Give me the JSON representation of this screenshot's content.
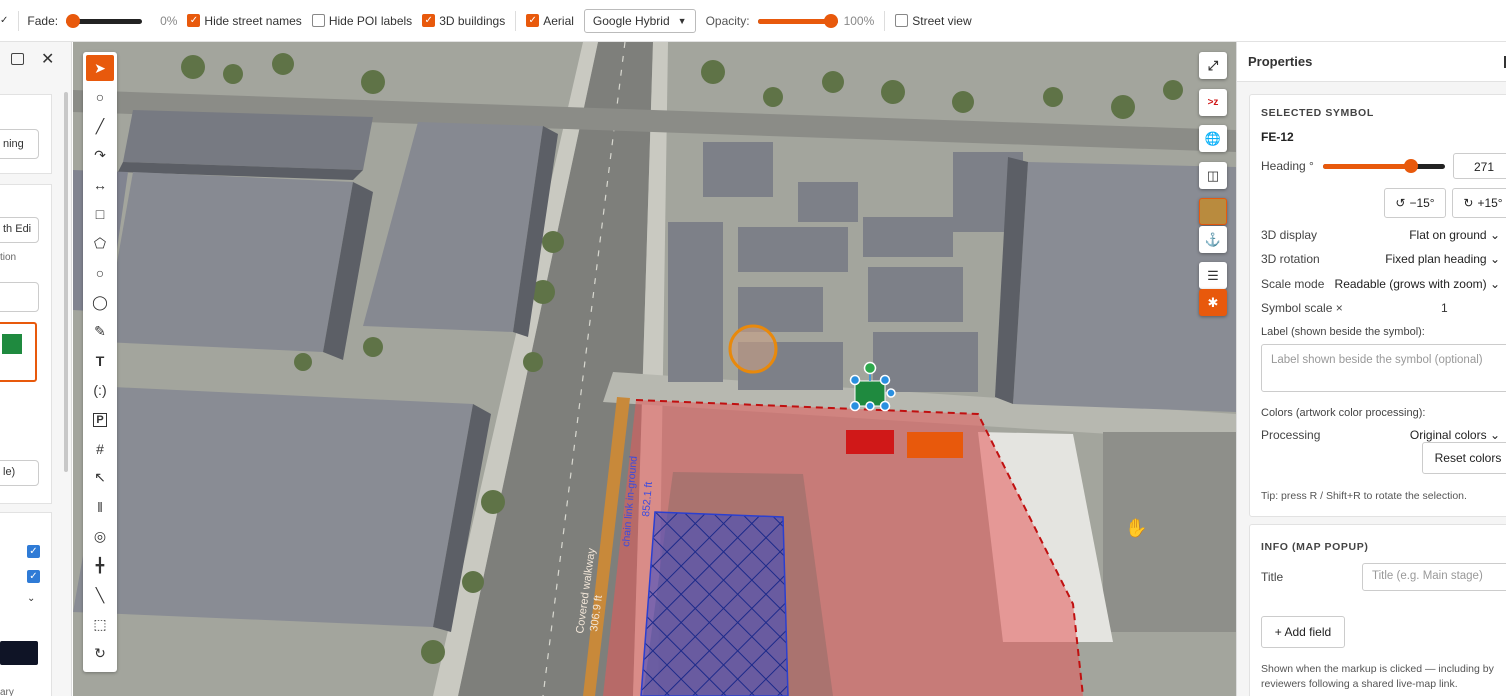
{
  "toolbar": {
    "fade_label": "Fade:",
    "fade_value": 0,
    "fade_text": "0%",
    "hide_street_names": {
      "label": "Hide street names",
      "checked": true
    },
    "hide_poi_labels": {
      "label": "Hide POI labels",
      "checked": false
    },
    "buildings_3d": {
      "label": "3D buildings",
      "checked": true
    },
    "aerial": {
      "label": "Aerial",
      "checked": true
    },
    "basemap_select": "Google Hybrid",
    "opacity_label": "Opacity:",
    "opacity_value": 1.0,
    "opacity_text": "100%",
    "street_view": {
      "label": "Street view",
      "checked": false
    }
  },
  "left": {
    "item1": "ning",
    "item2": "th Edi",
    "item3": "tion",
    "item4": "le)",
    "item5": "ary"
  },
  "map": {
    "covered_walkway_label": "Covered walkway",
    "covered_walkway_length": "306.9 ft",
    "chain_link_label": "chain link in-ground",
    "chain_link_length": "852.1 ft",
    "colors": {
      "fence_zone": "#e55a5a",
      "blue_hatch": "#3346c8",
      "selection": "#2a90e0",
      "orange_ring": "#e8890c",
      "walkway": "#c8893a"
    }
  },
  "map_controls": [
    "fullscreen-icon",
    "north-icon",
    "globe-icon",
    "compare-icon",
    "aerial-thumbnail-icon",
    "pin-icon",
    "layers-icon",
    "signal-icon"
  ],
  "tools": [
    "select-arrow",
    "lasso",
    "line",
    "curve",
    "measure",
    "rectangle",
    "pentagon",
    "circle",
    "circle-outline",
    "pencil",
    "text",
    "callout",
    "parking",
    "grid",
    "path",
    "road",
    "target",
    "fence",
    "ruler",
    "select-area",
    "rotate"
  ],
  "properties": {
    "title": "Properties",
    "selected_symbol_heading": "SELECTED SYMBOL",
    "symbol_id": "FE-12",
    "heading_label": "Heading °",
    "heading_value": "271",
    "heading_fraction": 0.75,
    "rotate_minus": "−15°",
    "rotate_plus": "+15°",
    "display_3d_label": "3D display",
    "display_3d_value": "Flat on ground",
    "rotation_3d_label": "3D rotation",
    "rotation_3d_value": "Fixed plan heading",
    "scale_mode_label": "Scale mode",
    "scale_mode_value": "Readable (grows with zoom)",
    "symbol_scale_label": "Symbol scale ×",
    "symbol_scale_value": "1",
    "label_field_label": "Label (shown beside the symbol):",
    "label_placeholder": "Label shown beside the symbol (optional)",
    "colors_label": "Colors (artwork color processing):",
    "processing_label": "Processing",
    "processing_value": "Original colors",
    "reset_colors": "Reset colors",
    "tip": "Tip: press R / Shift+R to rotate the selection.",
    "info_heading": "INFO (MAP POPUP)",
    "title_label": "Title",
    "title_placeholder": "Title (e.g. Main stage)",
    "add_field": "+ Add field",
    "footer_note_1": "Shown when the markup is clicked — including by",
    "footer_note_2": "reviewers following a shared live-map link."
  }
}
